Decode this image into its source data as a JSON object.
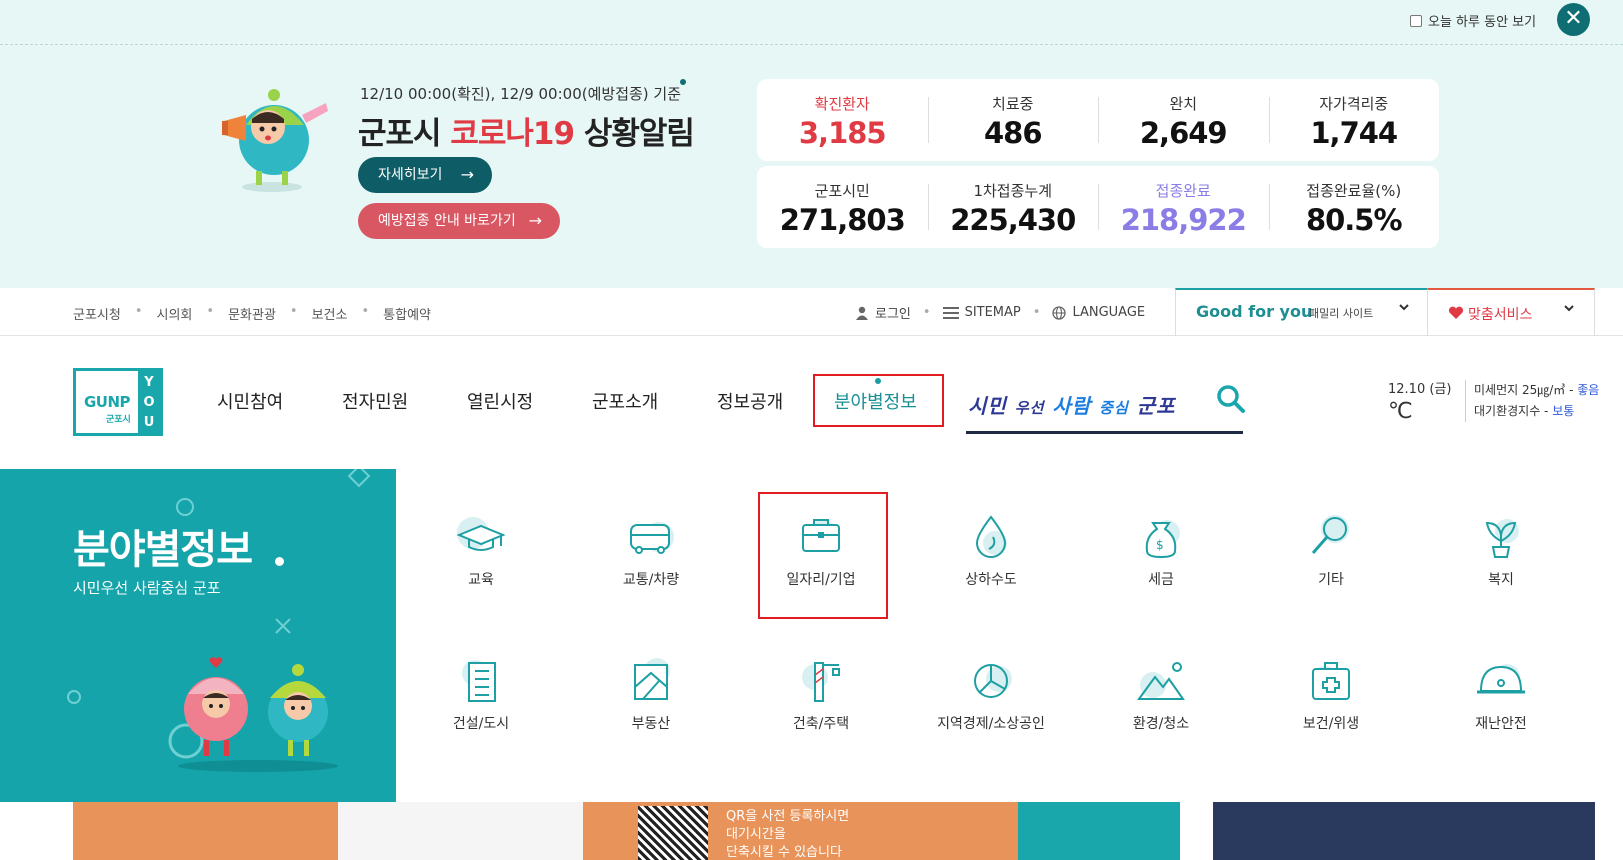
{
  "topbar": {
    "today_label": "오늘 하루 동안 보기",
    "close_label": "✕"
  },
  "banner": {
    "basis": "12/10 00:00(확진), 12/9 00:00(예방접종) 기준",
    "title_prefix": "군포시 ",
    "title_highlight": "코로나19",
    "title_suffix": " 상황알림",
    "detail_button": "자세히보기",
    "vaccine_button": "예방접종 안내 바로가기",
    "arrow": "→",
    "stats_row1": [
      {
        "label": "확진환자",
        "value": "3,185"
      },
      {
        "label": "치료중",
        "value": "486"
      },
      {
        "label": "완치",
        "value": "2,649"
      },
      {
        "label": "자가격리중",
        "value": "1,744"
      }
    ],
    "stats_row2": [
      {
        "label": "군포시민",
        "value": "271,803"
      },
      {
        "label": "1차접종누계",
        "value": "225,430"
      },
      {
        "label": "접종완료",
        "value": "218,922"
      },
      {
        "label": "접종완료율(%)",
        "value": "80.5%"
      }
    ]
  },
  "util": {
    "quick_links": [
      "군포시청",
      "시의회",
      "문화관광",
      "보건소",
      "통합예약"
    ],
    "login": "로그인",
    "sitemap": "SITEMAP",
    "language": "LANGUAGE",
    "good_for_you": "Good for you",
    "family_site": "패밀리 사이트",
    "custom_service": "맞춤서비스"
  },
  "gnb": {
    "logo_text": "GUNP",
    "logo_sub": "군포시",
    "logo_you": "YOU",
    "menus": [
      "시민참여",
      "전자민원",
      "열린시정",
      "군포소개",
      "정보공개",
      "분야별정보"
    ],
    "slogan_a1": "시민",
    "slogan_a2": "우선",
    "slogan_b1": "사람",
    "slogan_b2": "중심",
    "slogan_c": "군포",
    "weather_date": "12.10 (금)",
    "weather_deg": "℃",
    "dust_label": "미세먼지 25㎍/㎥ - ",
    "dust_status": "좋음",
    "air_label": "대기환경지수 - ",
    "air_status": "보통"
  },
  "mega": {
    "title": "분야별정보",
    "subtitle": "시민우선 사람중심 군포",
    "categories_row1": [
      "교육",
      "교통/차량",
      "일자리/기업",
      "상하수도",
      "세금",
      "기타",
      "복지"
    ],
    "categories_row2": [
      "건설/도시",
      "부동산",
      "건축/주택",
      "지역경제/소상공인",
      "환경/청소",
      "보건/위생",
      "재난안전"
    ]
  },
  "bottom": {
    "qr_line1": "QR을 사전 등록하시면",
    "qr_line2": "대기시간을",
    "qr_line3": "단축시킬 수 있습니다"
  },
  "colors": {
    "accent": "#15a4a9",
    "red": "#e03b45",
    "purple": "#8a7de6",
    "navy": "#0e5c66"
  }
}
